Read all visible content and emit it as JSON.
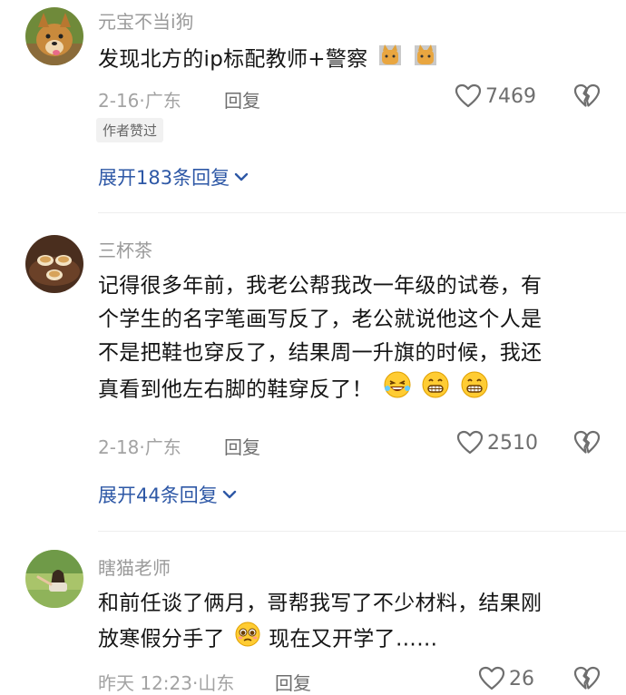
{
  "comments": [
    {
      "username": "元宝不当i狗",
      "text": "发现北方的ip标配教师+警察",
      "date": "2-16",
      "location": "广东",
      "reply_label": "回复",
      "likes": "7469",
      "badge": "作者赞过",
      "expand_label": "展开183条回复"
    },
    {
      "username": "三杯茶",
      "lines": [
        "记得很多年前，我老公帮我改一年级的试卷，有",
        "个学生的名字笔画写反了，老公就说他这个人是",
        "不是把鞋也穿反了，结果周一升旗的时候，我还",
        "真看到他左右脚的鞋穿反了！"
      ],
      "date": "2-18",
      "location": "广东",
      "reply_label": "回复",
      "likes": "2510",
      "expand_label": "展开44条回复"
    },
    {
      "username": "瞎猫老师",
      "lines": [
        "和前任谈了俩月，哥帮我写了不少材料，结果刚",
        "放寒假分手了",
        "现在又开学了……"
      ],
      "date": "昨天 12:23",
      "location": "山东",
      "reply_label": "回复",
      "likes": "26"
    }
  ],
  "separator": "·",
  "icons": {
    "like": "heart-outline-icon",
    "dislike": "broken-heart-icon",
    "expand": "chevron-down-icon",
    "emoji_cat": "cat-emoji",
    "emoji_laugh": "rofl-emoji",
    "emoji_grin": "grin-emoji",
    "emoji_sad": "pleading-emoji"
  },
  "colors": {
    "link": "#2e58a6",
    "text": "#141414",
    "muted": "#a3a3a3"
  }
}
